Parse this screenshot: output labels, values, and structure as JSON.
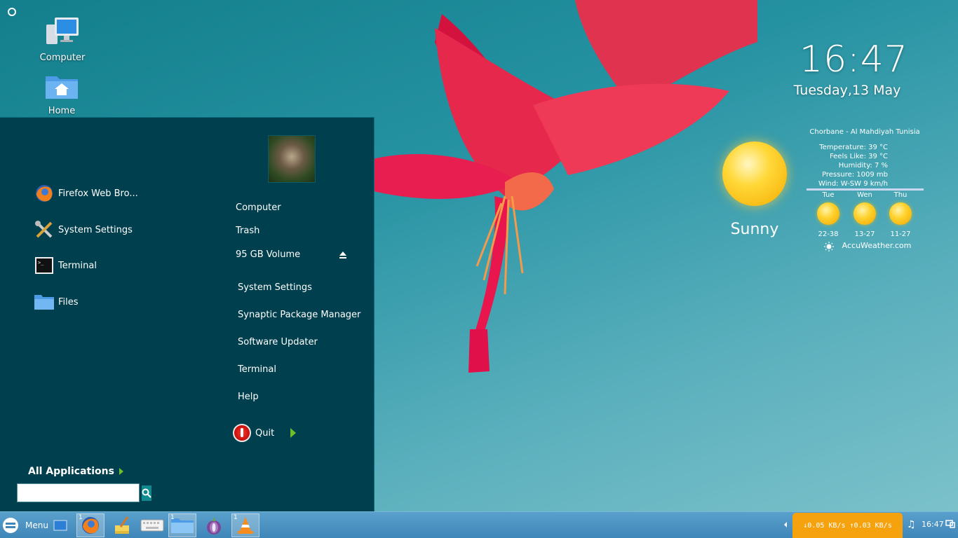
{
  "desktop": {
    "icons": [
      {
        "label": "Computer",
        "icon": "computer-icon"
      },
      {
        "label": "Home",
        "icon": "home-folder-icon"
      }
    ]
  },
  "clock": {
    "time": "16:47",
    "date": "Tuesday,13 May"
  },
  "weather": {
    "location": "Chorbane - Al Mahdiyah Tunisia",
    "details": [
      "Temperature: 39 °C",
      "Feels Like: 39 °C",
      "Humidity: 7 %",
      "Pressure: 1009 mb",
      "Wind: W-SW 9 km/h"
    ],
    "condition": "Sunny",
    "forecast": [
      {
        "day": "Tue",
        "range": "22-38"
      },
      {
        "day": "Wen",
        "range": "13-27"
      },
      {
        "day": "Thu",
        "range": "11-27"
      }
    ],
    "source": "AccuWeather.com"
  },
  "menu": {
    "favorites": [
      {
        "label": "Firefox Web Bro...",
        "icon": "firefox-icon"
      },
      {
        "label": "System Settings",
        "icon": "settings-tools-icon"
      },
      {
        "label": "Terminal",
        "icon": "terminal-icon"
      },
      {
        "label": "Files",
        "icon": "folder-icon"
      }
    ],
    "places": [
      "Computer",
      "Trash",
      "95 GB Volume"
    ],
    "system": [
      "System Settings",
      "Synaptic Package Manager",
      "Software Updater",
      "Terminal",
      "Help"
    ],
    "quit_label": "Quit",
    "all_apps_label": "All Applications",
    "search_value": ""
  },
  "taskbar": {
    "menu_label": "Menu",
    "badges": {
      "firefox": "1",
      "files": "1",
      "vlc": "1"
    },
    "net": "↓0.05 KB/s ↑0.03 KB/s",
    "time": "16:47",
    "music": "♫"
  }
}
